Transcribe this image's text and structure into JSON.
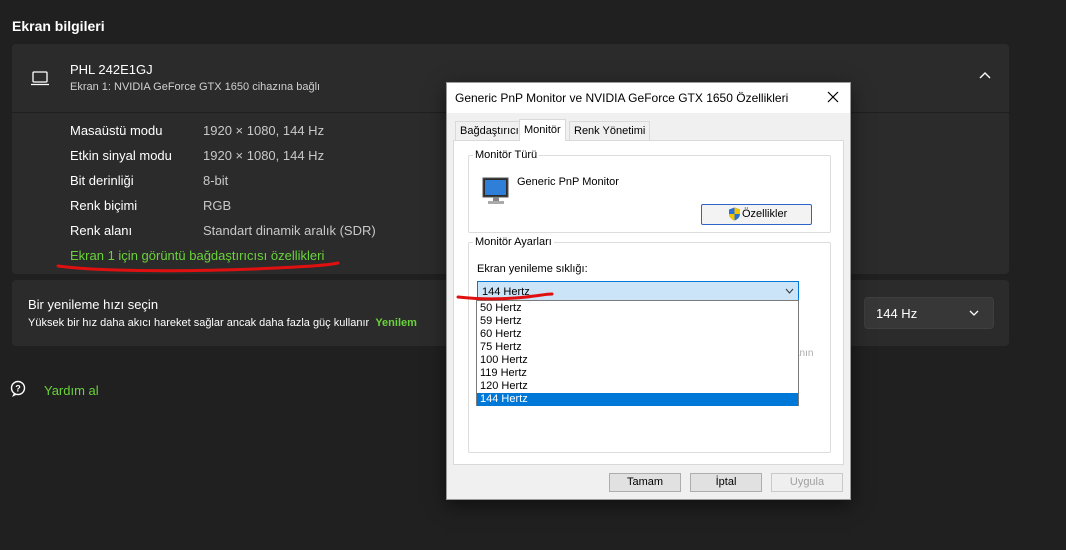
{
  "page": {
    "title": "Ekran bilgileri"
  },
  "monitor": {
    "name": "PHL 242E1GJ",
    "subtitle": "Ekran 1: NVIDIA GeForce GTX 1650 cihazına bağlı",
    "icon": "laptop-icon"
  },
  "info_rows": [
    {
      "label": "Masaüstü modu",
      "value": "1920 × 1080, 144 Hz"
    },
    {
      "label": "Etkin sinyal modu",
      "value": "1920 × 1080, 144 Hz"
    },
    {
      "label": "Bit derinliği",
      "value": "8-bit"
    },
    {
      "label": "Renk biçimi",
      "value": "RGB"
    },
    {
      "label": "Renk alanı",
      "value": "Standart dinamik aralık (SDR)"
    }
  ],
  "adapter_link": "Ekran 1 için görüntü bağdaştırıcısı özellikleri",
  "refresh": {
    "title": "Bir yenileme hızı seçin",
    "description": "Yüksek bir hız daha akıcı hareket sağlar ancak daha fazla güç kullanır",
    "link_partial": "Yenilem",
    "selected": "144 Hz"
  },
  "help": {
    "label": "Yardım al"
  },
  "dialog": {
    "title": "Generic PnP Monitor ve NVIDIA GeForce GTX 1650 Özellikleri",
    "tabs": [
      "Bağdaştırıcı",
      "Monitör",
      "Renk Yönetimi"
    ],
    "active_tab": "Monitör",
    "monitor_type_group": "Monitör Türü",
    "monitor_type": "Generic PnP Monitor",
    "properties_button": "Özellikler",
    "settings_group": "Monitör Ayarları",
    "refresh_label": "Ekran yenileme sıklığı:",
    "refresh_selected": "144 Hertz",
    "refresh_options": [
      "50 Hertz",
      "59 Hertz",
      "60 Hertz",
      "75 Hertz",
      "100 Hertz",
      "119 Hertz",
      "120 Hertz",
      "144 Hertz"
    ],
    "obscured_text_fragment": "anın",
    "buttons": {
      "ok": "Tamam",
      "cancel": "İptal",
      "apply": "Uygula"
    }
  },
  "colors": {
    "background": "#202020",
    "card": "#2b2b2b",
    "link_green": "#6ad23a",
    "annotation_red": "#e01010",
    "selection_blue": "#0078d7"
  }
}
